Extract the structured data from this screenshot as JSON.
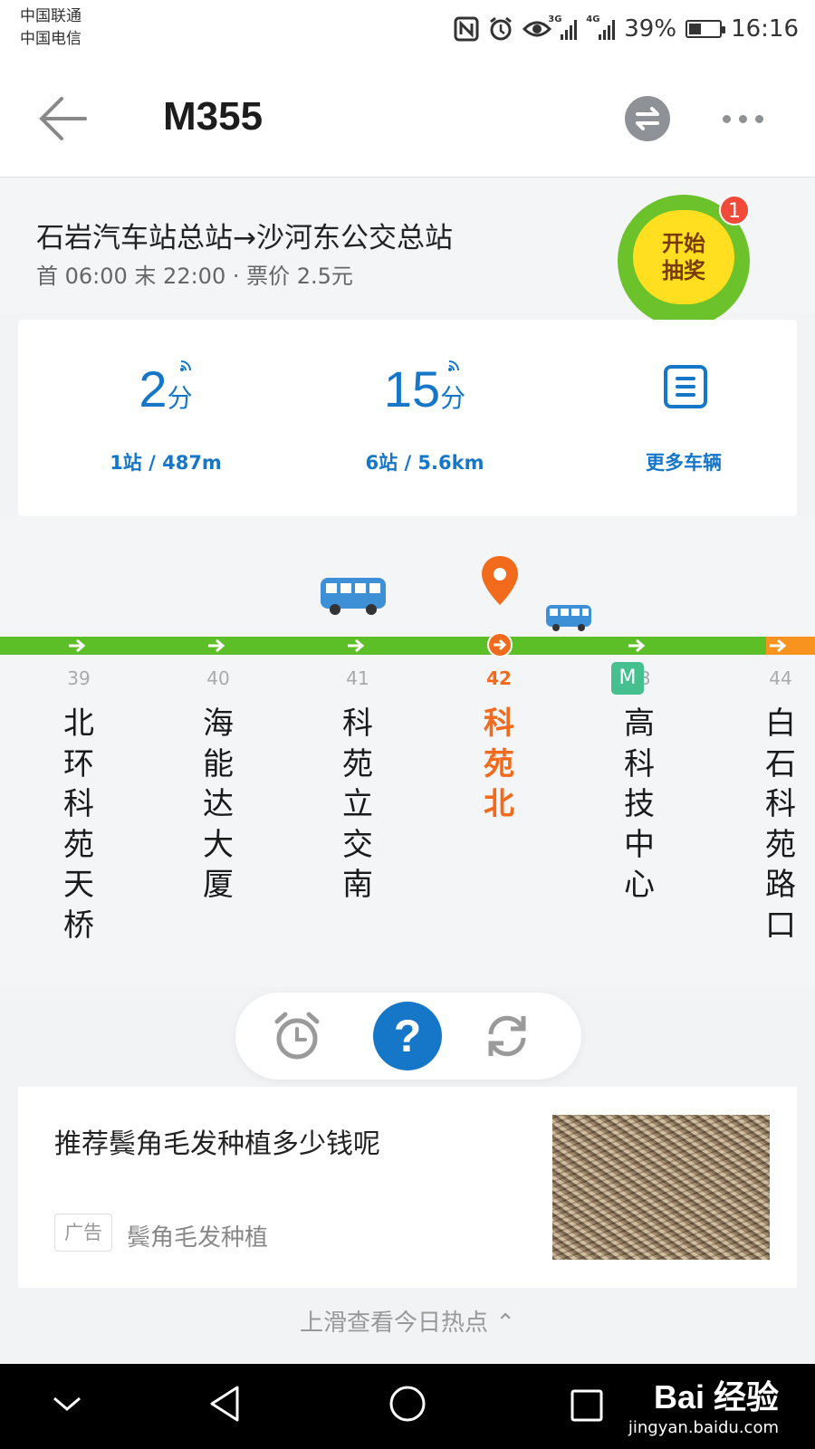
{
  "status_bar": {
    "carrier_1": "中国联通",
    "carrier_2": "中国电信",
    "network_1": "3G",
    "network_2": "4G",
    "battery": "39%",
    "time": "16:16",
    "icons": [
      "nfc-icon",
      "alarm-icon",
      "eye-care-icon",
      "signal-icon",
      "battery-icon"
    ]
  },
  "header": {
    "title": "M355",
    "back_icon": "arrow-left-icon",
    "swap_icon": "swap-direction-icon",
    "more_icon": "more-dots-icon"
  },
  "route": {
    "direction": "石岩汽车站总站→沙河东公交总站",
    "times": "首 06:00 末 22:00 · 票价 2.5元",
    "lottery_label": "开始抽奖",
    "lottery_badge": "1"
  },
  "arrivals": [
    {
      "minutes": "2",
      "unit": "分",
      "detail": "1站 / 487m"
    },
    {
      "minutes": "15",
      "unit": "分",
      "detail": "6站 / 5.6km"
    }
  ],
  "more_vehicles": "更多车辆",
  "stops": [
    {
      "num": "39",
      "name": "北环科苑天桥",
      "current": false
    },
    {
      "num": "40",
      "name": "海能达大厦",
      "current": false
    },
    {
      "num": "41",
      "name": "科苑立交南",
      "current": false
    },
    {
      "num": "42",
      "name": "科苑北",
      "current": true
    },
    {
      "num": "43",
      "name": "高科技中心",
      "current": false
    },
    {
      "num": "44",
      "name": "白石科苑路口",
      "current": false
    }
  ],
  "metro_badge": "M",
  "actions": {
    "alarm_icon": "alarm-clock-icon",
    "help_label": "?",
    "refresh_icon": "refresh-icon"
  },
  "ad": {
    "title": "推荐鬓角毛发种植多少钱呢",
    "tag": "广告",
    "source": "鬓角毛发种植"
  },
  "footer_hint": "上滑查看今日热点 ⌃",
  "watermark": {
    "brand": "Bai 经验",
    "url": "jingyan.baidu.com"
  },
  "colors": {
    "accent_blue": "#1677c9",
    "line_green": "#5dbf27",
    "current_orange": "#f26b1d",
    "metro_green": "#45c08e"
  }
}
